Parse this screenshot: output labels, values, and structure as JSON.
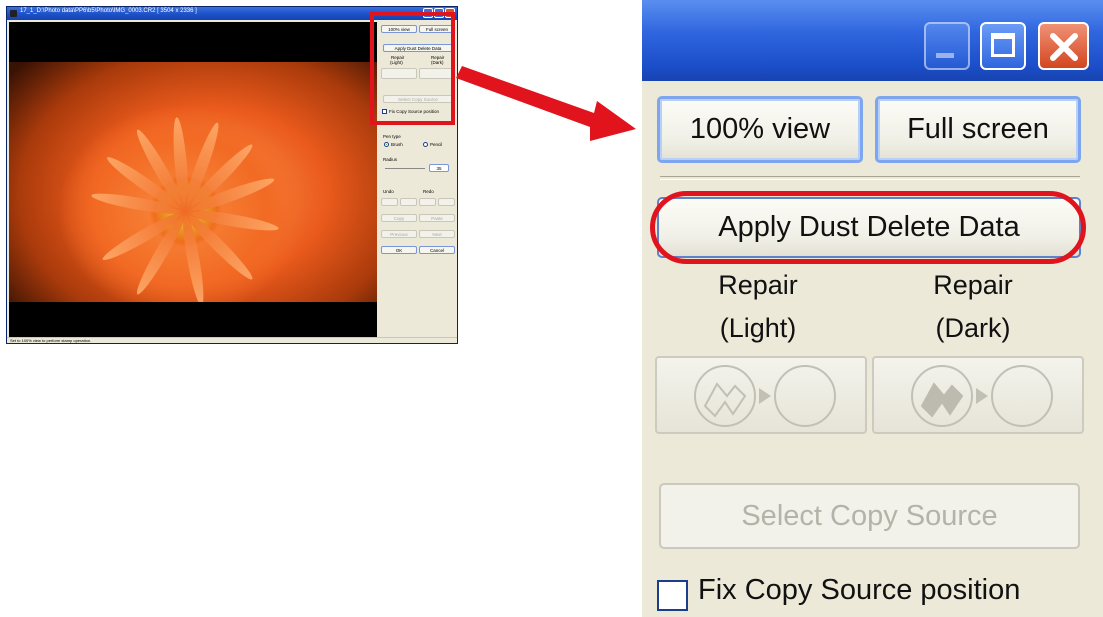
{
  "small_window": {
    "title": "17_1_D:\\Photo data\\PP6\\b5\\Photo\\IMG_0003.CR2 [ 3504 x 2336 ]",
    "status": "Set to 100% view to perform stamp operation.",
    "buttons": {
      "view_100": "100% view",
      "full_screen": "Full screen",
      "apply_dust": "Apply Dust Delete Data",
      "select_copy": "Select Copy Source",
      "copy": "Copy",
      "paste": "Paste",
      "previous": "Previous",
      "next": "Next",
      "ok": "OK",
      "cancel": "Cancel"
    },
    "repair_light": [
      "Repair",
      "(Light)"
    ],
    "repair_dark": [
      "Repair",
      "(Dark)"
    ],
    "fix_copy": "Fix Copy Source position",
    "pen_type": "Pen type",
    "brush": "Brush",
    "pencil": "Pencil",
    "radius": "Radius",
    "radius_value": "35",
    "undo": "Undo",
    "redo": "Redo"
  },
  "zoom_panel": {
    "view_100": "100% view",
    "full_screen": "Full screen",
    "apply_dust": "Apply Dust Delete Data",
    "repair_light_1": "Repair",
    "repair_light_2": "(Light)",
    "repair_dark_1": "Repair",
    "repair_dark_2": "(Dark)",
    "select_copy": "Select Copy Source",
    "fix_copy": "Fix Copy Source position"
  },
  "colors": {
    "highlight": "#e1141e",
    "titlebar": "#2f66de",
    "panel_bg": "#ece9d8"
  }
}
